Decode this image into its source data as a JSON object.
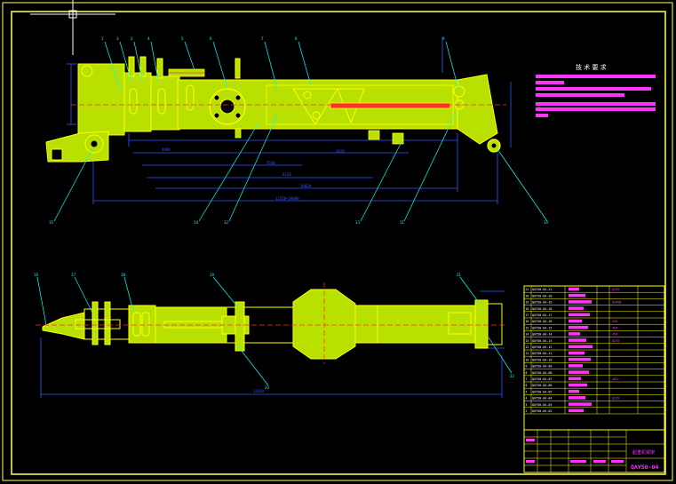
{
  "colors": {
    "background": "#000000",
    "frame": "#ffff55",
    "outline": "#ffff00",
    "part_fill": "#b8e000",
    "dimension": "#3355ff",
    "centerline": "#ff3030",
    "leader": "#00ffff",
    "magenta": "#ff33ff",
    "cursor": "#ffffff"
  },
  "technical_requirements": {
    "title": "技 术 要 求"
  },
  "title_block": {
    "drawing_name": "起重机臂架",
    "drawing_number": "QAY50-04"
  },
  "bom_codes": [
    "QAY50-04-21",
    "QAY50-04-20",
    "QAY50-04-19",
    "QAY50-04-18",
    "QAY50-04-17",
    "QAY50-04-16",
    "QAY50-04-15",
    "QAY50-04-14",
    "QAY50-04-13",
    "QAY50-04-12",
    "QAY50-04-11",
    "QAY50-04-10",
    "QAY50-04-09",
    "QAY50-04-08",
    "QAY50-04-07",
    "QAY50-04-06",
    "QAY50-04-05",
    "QAY50-04-04",
    "QAY50-04-03",
    "QAY50-04-02"
  ],
  "bom_materials": [
    "Q235",
    "",
    "Q345B",
    "",
    "",
    "45#",
    "45#",
    "45#",
    "Q235",
    "",
    "",
    "",
    "",
    "",
    "40Cr",
    "",
    "",
    "Q235",
    "",
    ""
  ],
  "top_view_balloons": [
    "1",
    "3",
    "2",
    "4",
    "5",
    "6",
    "7",
    "8",
    "9",
    "10",
    "11",
    "12",
    "13",
    "14",
    "15"
  ],
  "bottom_view_balloons": [
    "16",
    "17",
    "18",
    "19",
    "20",
    "21",
    "22"
  ]
}
